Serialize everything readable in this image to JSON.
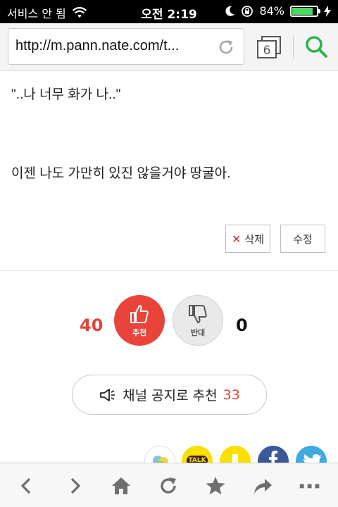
{
  "status_bar": {
    "carrier": "서비스 안 됨",
    "time": "오전 2:19",
    "battery_percent": "84%",
    "battery_level": 0.84
  },
  "browser": {
    "url": "http://m.pann.nate.com/t...",
    "tab_count": "6"
  },
  "comment": {
    "line1": "\"..나 너무 화가 나..\"",
    "line2": "이젠 나도 가만히 있진 않을거야 땅굴아."
  },
  "actions": {
    "delete_label": "삭제",
    "edit_label": "수정"
  },
  "votes": {
    "up_count": "40",
    "up_label": "추천",
    "down_label": "반대",
    "down_count": "0"
  },
  "channel": {
    "label": "채널 공지로 추천",
    "count": "33"
  },
  "share": {
    "kakao_talk_label": "TALK"
  },
  "colors": {
    "accent_red": "#e8443a",
    "search_green": "#2bb24c",
    "facebook": "#3b5998",
    "twitter": "#3fa9e0",
    "kakao_yellow": "#f9e000"
  }
}
